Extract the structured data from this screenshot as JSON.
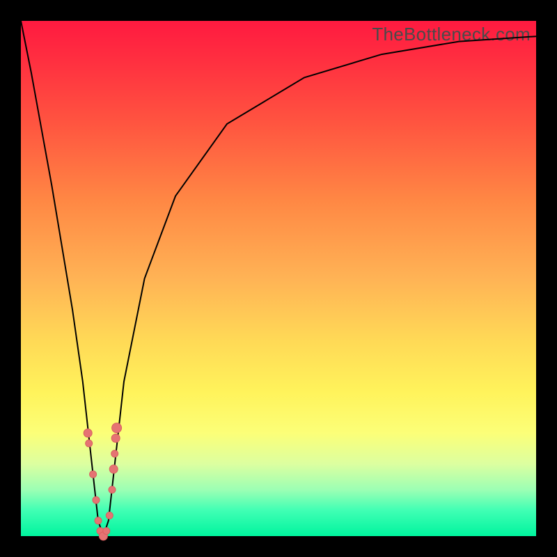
{
  "watermark": "TheBottleneck.com",
  "colors": {
    "frame": "#000000",
    "curve": "#000000",
    "marker": "#e57373",
    "marker_stroke": "#d95f5f"
  },
  "chart_data": {
    "type": "line",
    "title": "",
    "xlabel": "",
    "ylabel": "",
    "xlim": [
      0,
      100
    ],
    "ylim": [
      0,
      100
    ],
    "grid": false,
    "legend_position": "none",
    "series": [
      {
        "name": "bottleneck-curve",
        "x": [
          0,
          2,
          4,
          6,
          8,
          10,
          12,
          14,
          15,
          16,
          17,
          18,
          20,
          24,
          30,
          40,
          55,
          70,
          85,
          100
        ],
        "y": [
          100,
          90,
          79,
          68,
          56,
          44,
          30,
          12,
          3,
          0,
          3,
          12,
          30,
          50,
          66,
          80,
          89,
          93.5,
          96,
          97
        ]
      }
    ],
    "markers": {
      "name": "highlighted-points",
      "x": [
        13,
        13.2,
        14,
        14.6,
        15,
        15.4,
        16,
        16.6,
        17.2,
        17.7,
        18,
        18.2,
        18.4,
        18.6
      ],
      "y": [
        20,
        18,
        12,
        7,
        3,
        1,
        0,
        1,
        4,
        9,
        13,
        16,
        19,
        21
      ],
      "r": [
        6,
        5,
        5,
        5,
        5,
        5,
        6,
        5,
        5,
        5,
        6,
        5,
        6,
        7
      ]
    }
  }
}
